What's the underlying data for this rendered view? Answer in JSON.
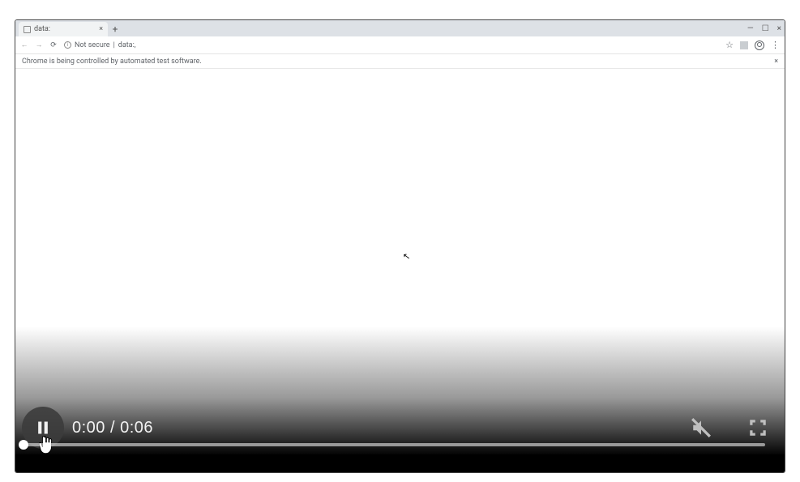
{
  "browser": {
    "tab_title": "data:",
    "new_tab_label": "+",
    "window_controls": {
      "minimize": "—",
      "maximize": "☐",
      "close": "×"
    },
    "nav": {
      "back": "←",
      "forward": "→",
      "reload": "⟳"
    },
    "address": {
      "not_secure": "Not secure",
      "separator": "|",
      "url": "data:,"
    },
    "toolbar_icons": {
      "star": "☆",
      "menu": "⋮"
    },
    "info_bar": {
      "text": "Chrome is being controlled by automated test software.",
      "close": "×"
    }
  },
  "video": {
    "current_time": "0:00",
    "time_separator": " / ",
    "duration": "0:06",
    "progress_percent": 0,
    "state": "playing"
  }
}
